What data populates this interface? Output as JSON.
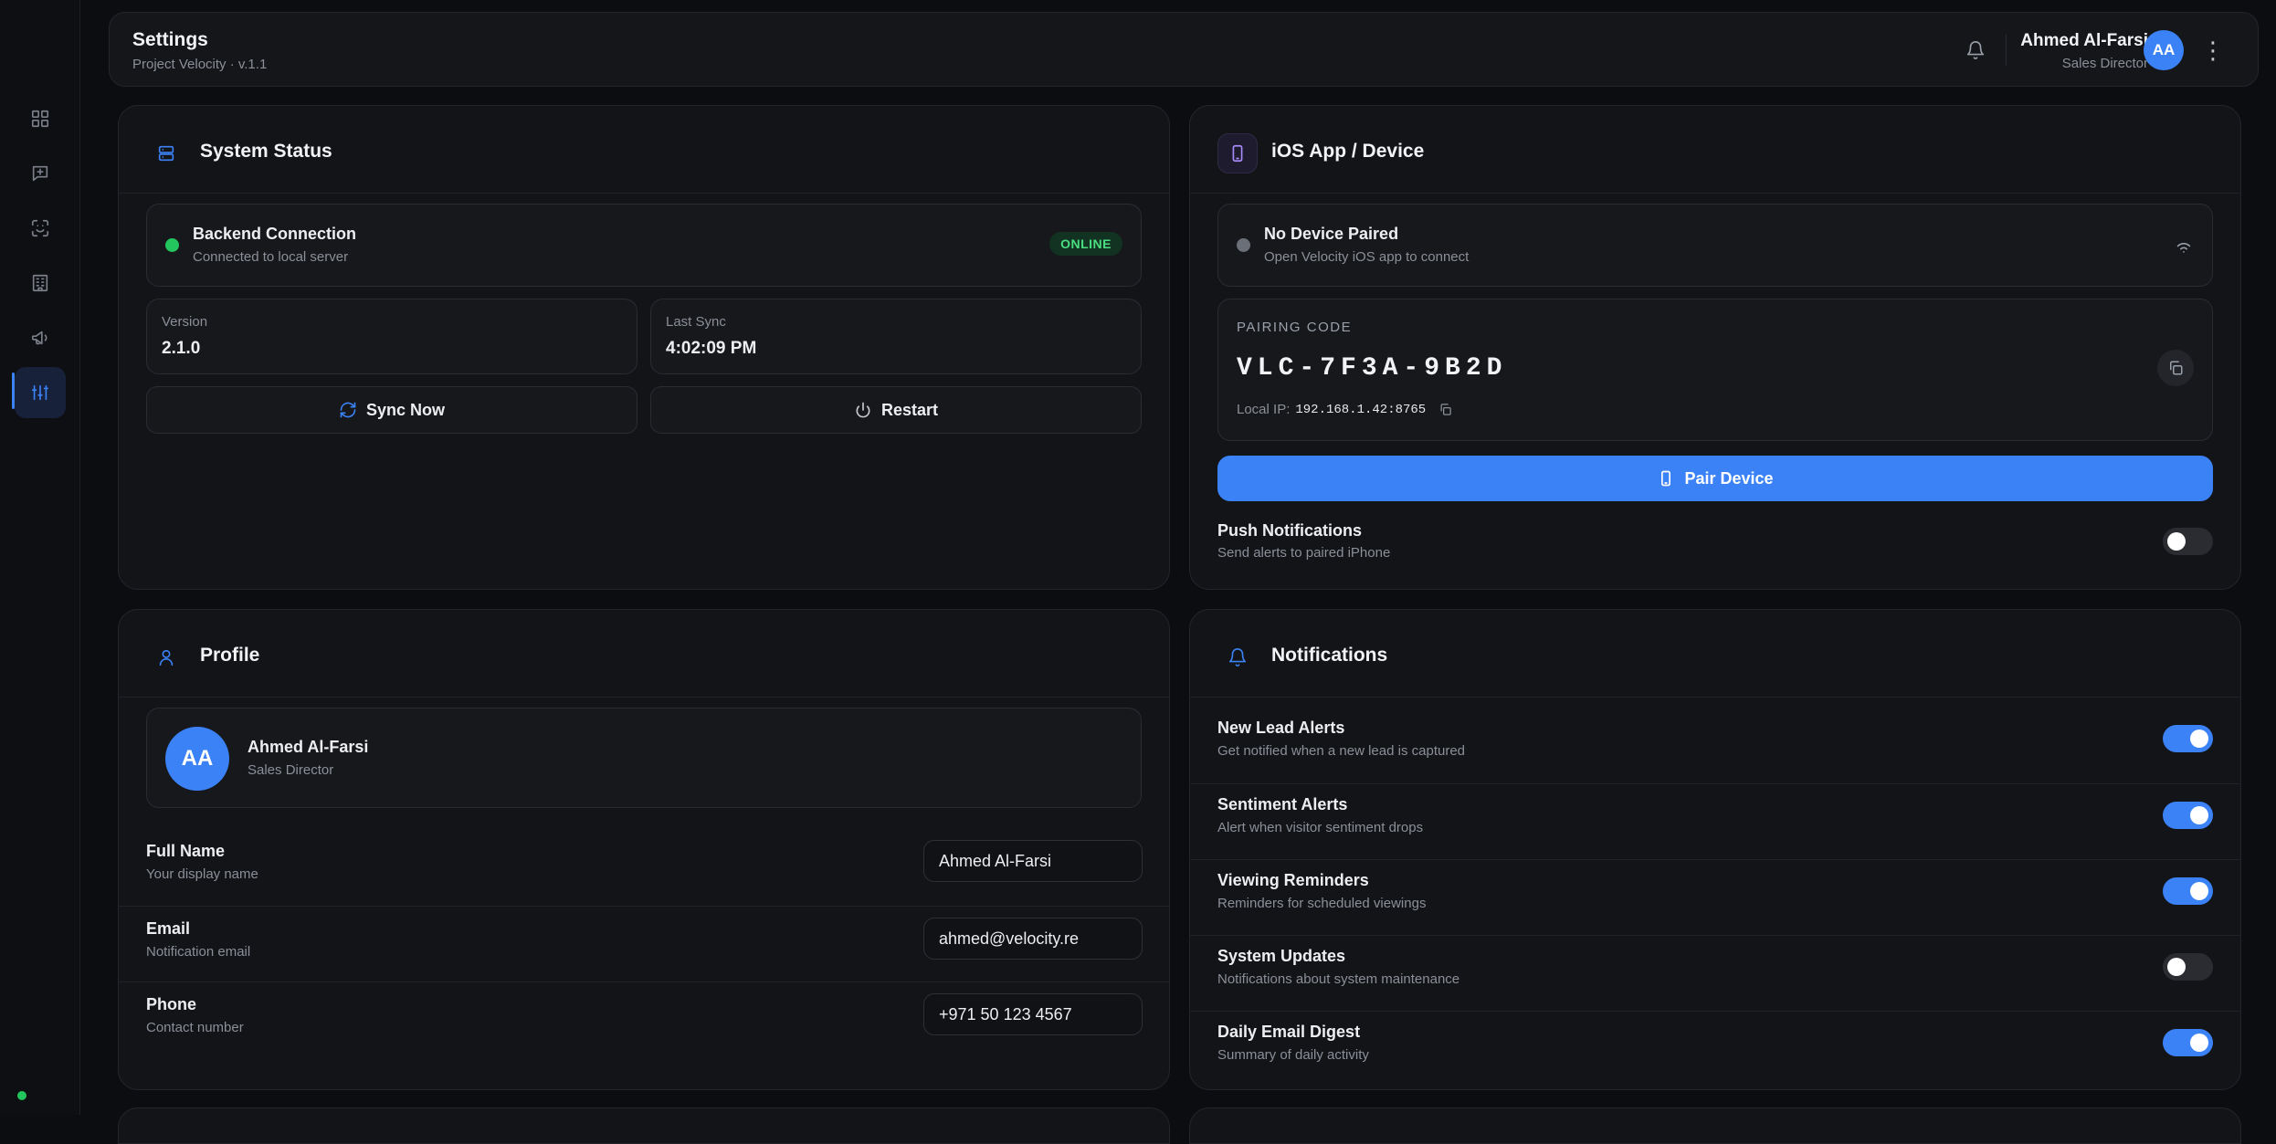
{
  "header": {
    "title": "Settings",
    "subtitle": "Project Velocity · v.1.1",
    "user": {
      "name": "Ahmed Al-Farsi",
      "role": "Sales Director",
      "initials": "AA"
    },
    "more_glyph": "⋮"
  },
  "sidebar": {
    "items": [
      {
        "icon": "dashboard-icon"
      },
      {
        "icon": "chat-add-icon"
      },
      {
        "icon": "scan-face-icon"
      },
      {
        "icon": "building-icon"
      },
      {
        "icon": "megaphone-icon"
      },
      {
        "icon": "sliders-icon",
        "active": true
      }
    ]
  },
  "system_status": {
    "title": "System Status",
    "backend": {
      "title": "Backend Connection",
      "subtitle": "Connected to local server",
      "badge": "ONLINE"
    },
    "version": {
      "label": "Version",
      "value": "2.1.0"
    },
    "last_sync": {
      "label": "Last Sync",
      "value": "4:02:09 PM"
    },
    "sync_button": "Sync Now",
    "restart_button": "Restart"
  },
  "ios_device": {
    "title": "iOS App / Device",
    "pairing": {
      "title": "No Device Paired",
      "subtitle": "Open Velocity iOS app to connect"
    },
    "code_label": "PAIRING CODE",
    "code": "VLC-7F3A-9B2D",
    "local_ip_label": "Local IP:",
    "local_ip": "192.168.1.42:8765",
    "pair_button": "Pair Device",
    "push": {
      "title": "Push Notifications",
      "subtitle": "Send alerts to paired iPhone",
      "enabled": false
    }
  },
  "profile": {
    "title": "Profile",
    "card": {
      "initials": "AA",
      "name": "Ahmed Al-Farsi",
      "role": "Sales Director"
    },
    "fields": [
      {
        "label": "Full Name",
        "sub": "Your display name",
        "value": "Ahmed Al-Farsi"
      },
      {
        "label": "Email",
        "sub": "Notification email",
        "value": "ahmed@velocity.re"
      },
      {
        "label": "Phone",
        "sub": "Contact number",
        "value": "+971 50 123 4567"
      }
    ]
  },
  "notifications": {
    "title": "Notifications",
    "items": [
      {
        "title": "New Lead Alerts",
        "sub": "Get notified when a new lead is captured",
        "enabled": true
      },
      {
        "title": "Sentiment Alerts",
        "sub": "Alert when visitor sentiment drops",
        "enabled": true
      },
      {
        "title": "Viewing Reminders",
        "sub": "Reminders for scheduled viewings",
        "enabled": true
      },
      {
        "title": "System Updates",
        "sub": "Notifications about system maintenance",
        "enabled": false
      },
      {
        "title": "Daily Email Digest",
        "sub": "Summary of daily activity",
        "enabled": true
      }
    ]
  },
  "colors": {
    "accent": "#3b82f6",
    "online": "#22c55e",
    "background": "#0c0d10",
    "card": "#131418"
  }
}
